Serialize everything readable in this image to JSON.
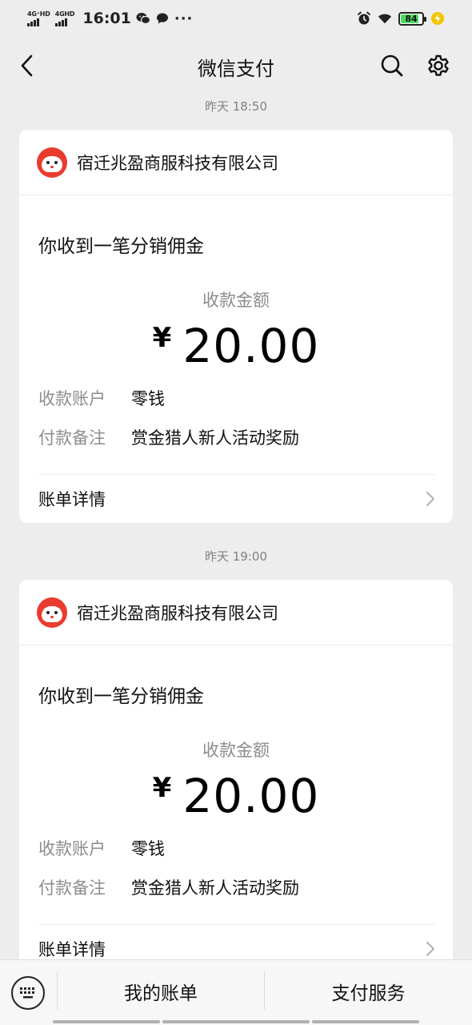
{
  "status_bar": {
    "signal1_label": "4G⁺HD",
    "signal2_label": "4GHD",
    "time": "16:01",
    "more": "···",
    "battery_level": "84",
    "battery_fraction": 0.84,
    "icons": [
      "wechat-icon",
      "message-icon",
      "alarm-icon",
      "wifi-icon",
      "charging-icon"
    ]
  },
  "nav": {
    "title": "微信支付",
    "back_icon": "chevron-left-icon",
    "search_icon": "search-icon",
    "settings_icon": "gear-icon"
  },
  "messages": [
    {
      "timestamp": "昨天 18:50",
      "merchant": "宿迁兆盈商服科技有限公司",
      "title": "你收到一笔分销佣金",
      "amount_label": "收款金额",
      "currency": "¥",
      "amount": "20.00",
      "account_label": "收款账户",
      "account_value": "零钱",
      "note_label": "付款备注",
      "note_value": "赏金猎人新人活动奖励",
      "detail_label": "账单详情"
    },
    {
      "timestamp": "昨天 19:00",
      "merchant": "宿迁兆盈商服科技有限公司",
      "title": "你收到一笔分销佣金",
      "amount_label": "收款金额",
      "currency": "¥",
      "amount": "20.00",
      "account_label": "收款账户",
      "account_value": "零钱",
      "note_label": "付款备注",
      "note_value": "赏金猎人新人活动奖励",
      "detail_label": "账单详情"
    }
  ],
  "bottom_bar": {
    "keyboard_icon": "keyboard-icon",
    "tab1": "我的账单",
    "tab2": "支付服务"
  },
  "colors": {
    "background": "#ededed",
    "card": "#ffffff",
    "logo_red": "#e93b2e",
    "muted_text": "#8c8c8c",
    "battery_green": "#4cd964"
  }
}
